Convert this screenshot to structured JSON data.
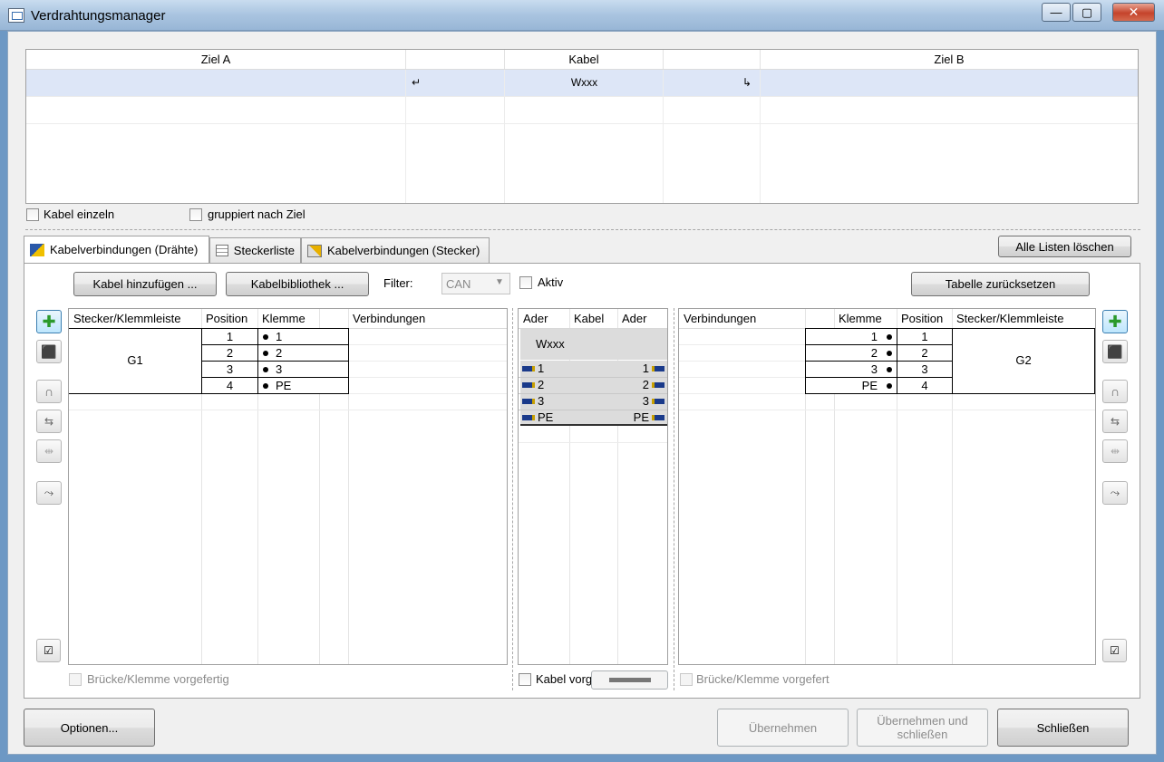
{
  "window": {
    "title": "Verdrahtungsmanager",
    "min": "—",
    "max": "▢",
    "close": "✕"
  },
  "cable_table": {
    "headers": [
      "Ziel A",
      "Kabel",
      "Ziel B"
    ],
    "row": {
      "cable": "Wxxx",
      "left_arrow": "↵",
      "right_arrow": "↳"
    }
  },
  "options": {
    "kabel_einzeln": "Kabel einzeln",
    "gruppiert": "gruppiert nach Ziel"
  },
  "tabs": [
    "Kabelverbindungen (Drähte)",
    "Steckerliste",
    "Kabelverbindungen (Stecker)"
  ],
  "toolbar": {
    "alle_listen_loeschen": "Alle Listen löschen",
    "kabel_hinzufuegen": "Kabel hinzufügen ...",
    "kabelbibliothek": "Kabelbibliothek ...",
    "filter_label": "Filter:",
    "filter_value": "CAN",
    "aktiv": "Aktiv",
    "tabelle_zuruecksetzen": "Tabelle zurücksetzen"
  },
  "left_grid": {
    "headers": [
      "Stecker/Klemmleiste",
      "Position",
      "Klemme",
      "",
      "Verbindungen"
    ],
    "device": "G1",
    "rows": [
      {
        "position": "1",
        "klemme": "1"
      },
      {
        "position": "2",
        "klemme": "2"
      },
      {
        "position": "3",
        "klemme": "3"
      },
      {
        "position": "4",
        "klemme": "PE"
      }
    ],
    "footer": "Brücke/Klemme vorgefertig"
  },
  "mid_grid": {
    "headers": [
      "Ader",
      "Kabel",
      "Ader"
    ],
    "cable": "Wxxx",
    "rows": [
      {
        "left": "1",
        "right": "1"
      },
      {
        "left": "2",
        "right": "2"
      },
      {
        "left": "3",
        "right": "3"
      },
      {
        "left": "PE",
        "right": "PE"
      }
    ],
    "footer": "Kabel vorg"
  },
  "right_grid": {
    "headers": [
      "Verbindungen",
      "Klemme",
      "Position",
      "Stecker/Klemmleiste"
    ],
    "device": "G2",
    "rows": [
      {
        "klemme": "1",
        "position": "1"
      },
      {
        "klemme": "2",
        "position": "2"
      },
      {
        "klemme": "3",
        "position": "3"
      },
      {
        "klemme": "PE",
        "position": "4"
      }
    ],
    "footer": "Brücke/Klemme vorgefert"
  },
  "bottom": {
    "optionen": "Optionen...",
    "uebernehmen": "Übernehmen",
    "uebernehmen_schliessen": "Übernehmen und schließen",
    "schliessen": "Schließen"
  },
  "icons": [
    "add-cable-icon",
    "remove-cable-icon",
    "bridge-icon",
    "connect-icon",
    "disconnect-icon",
    "auto-wire-icon",
    "check-all-icon"
  ]
}
